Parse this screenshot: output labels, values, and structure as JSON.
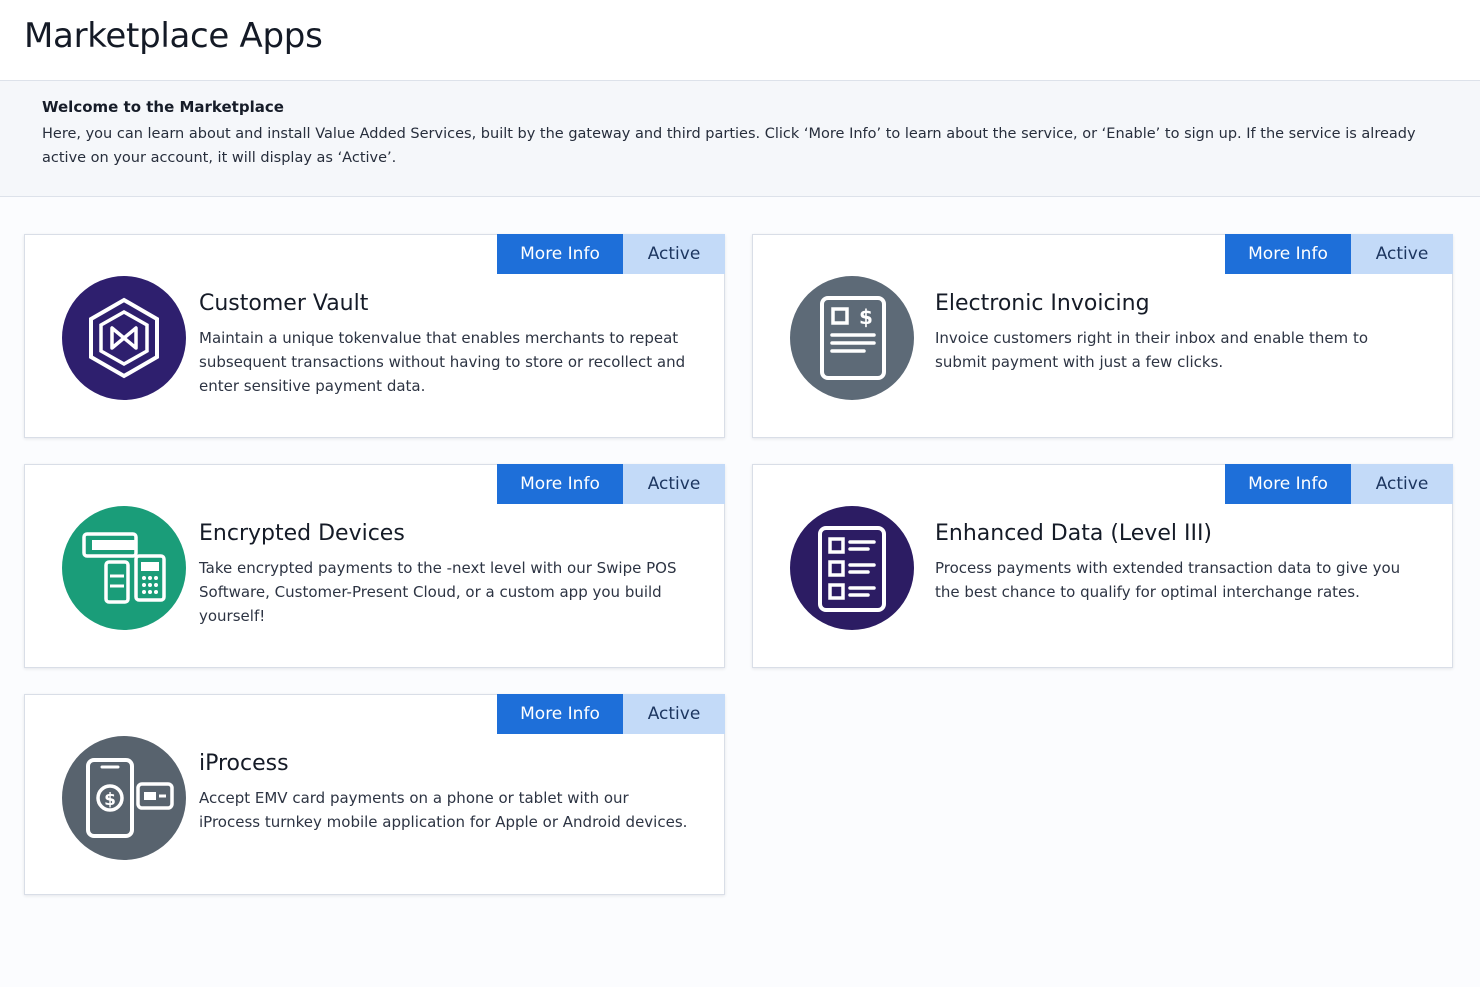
{
  "header": {
    "title": "Marketplace Apps"
  },
  "welcome": {
    "title": "Welcome to the Marketplace",
    "text": "Here, you can learn about and install  Value Added Services, built by the gateway and third parties. Click ‘More Info’ to learn about the service, or ‘Enable’ to sign up. If the service is already active on your account, it will display as ‘Active’."
  },
  "colors": {
    "primary_button": "#1e6fd9",
    "active_button": "#c3daf8",
    "vault_icon_bg": "#2e1f6e",
    "invoice_icon_bg": "#5d6a77",
    "devices_icon_bg": "#1a9d79",
    "enhanced_icon_bg": "#2c1c63",
    "iprocess_icon_bg": "#58636e"
  },
  "apps": [
    {
      "title": "Customer Vault",
      "description": "Maintain a unique tokenvalue that enables merchants to repeat subsequent transactions without having to store or recollect and enter sensitive payment data.",
      "icon": "vault-hexagon-icon",
      "more_info_label": "More Info",
      "status_label": "Active"
    },
    {
      "title": "Electronic Invoicing",
      "description": "Invoice customers right in their inbox and enable them to submit payment with just a few clicks.",
      "icon": "invoice-document-icon",
      "more_info_label": "More Info",
      "status_label": "Active"
    },
    {
      "title": "Encrypted Devices",
      "description": "Take encrypted payments to the -next level with our Swipe POS Software, Customer-Present Cloud, or a custom app you build yourself!",
      "icon": "payment-terminal-icon",
      "more_info_label": "More Info",
      "status_label": "Active"
    },
    {
      "title": "Enhanced Data (Level III)",
      "description": "Process payments with extended transaction data to give you the best chance to qualify for optimal interchange rates.",
      "icon": "checklist-document-icon",
      "more_info_label": "More Info",
      "status_label": "Active"
    },
    {
      "title": "iProcess",
      "description": "Accept EMV card payments on a phone or tablet with our iProcess turnkey mobile application for Apple or Android devices.",
      "icon": "mobile-payment-icon",
      "more_info_label": "More Info",
      "status_label": "Active"
    }
  ]
}
